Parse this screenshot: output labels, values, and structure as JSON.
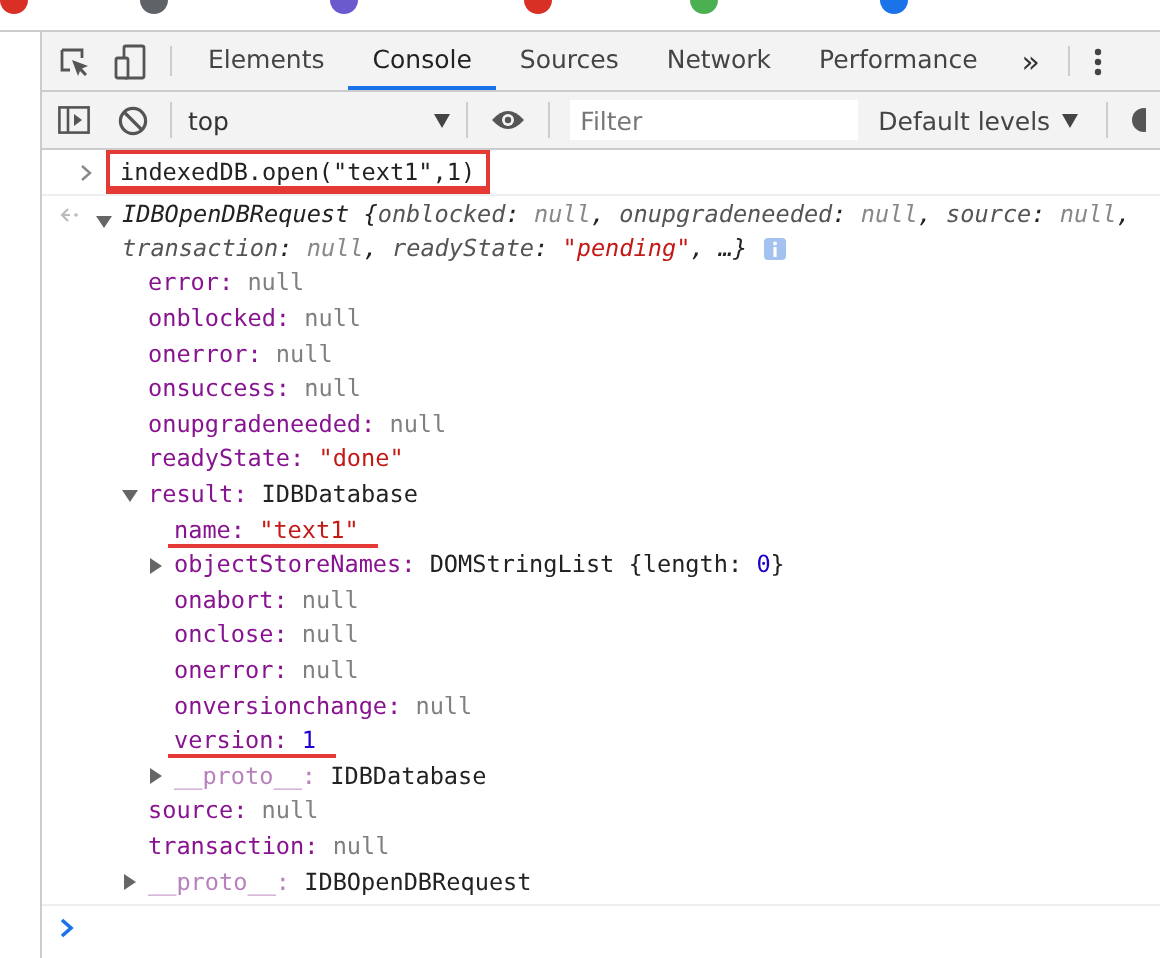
{
  "bookmarks_bar": {
    "icons": [
      {
        "color": "#d93025"
      },
      {
        "color": "#5f6368"
      },
      {
        "color": "#6a5acd"
      },
      {
        "color": "#d93025"
      },
      {
        "color": "#4caf50"
      },
      {
        "color": "#1a73e8"
      }
    ]
  },
  "tabs": [
    {
      "label": "Elements",
      "selected": false
    },
    {
      "label": "Console",
      "selected": true
    },
    {
      "label": "Sources",
      "selected": false
    },
    {
      "label": "Network",
      "selected": false
    },
    {
      "label": "Performance",
      "selected": false
    }
  ],
  "more_tabs": "»",
  "toolbar": {
    "context": "top",
    "filter": {
      "placeholder": "Filter"
    },
    "levels": "Default levels"
  },
  "console": {
    "input": {
      "text": "indexedDB.open(\"text1\",1)",
      "marked": true
    },
    "output": {
      "expanded": true,
      "summary": [
        [
          {
            "text": "IDBOpenDBRequest {",
            "kind": "plain"
          },
          {
            "text": "onblocked",
            "kind": "key"
          },
          {
            "text": ": ",
            "kind": "plain"
          },
          {
            "text": "null",
            "kind": "null"
          },
          {
            "text": ", ",
            "kind": "plain"
          },
          {
            "text": "onupgradeneeded",
            "kind": "key"
          },
          {
            "text": ": ",
            "kind": "plain"
          },
          {
            "text": "null",
            "kind": "null"
          },
          {
            "text": ", ",
            "kind": "plain"
          },
          {
            "text": "source",
            "kind": "key"
          },
          {
            "text": ": ",
            "kind": "plain"
          },
          {
            "text": "null",
            "kind": "null"
          },
          {
            "text": ",",
            "kind": "plain"
          }
        ],
        [
          {
            "text": "transaction",
            "kind": "key"
          },
          {
            "text": ": ",
            "kind": "plain"
          },
          {
            "text": "null",
            "kind": "null"
          },
          {
            "text": ", ",
            "kind": "plain"
          },
          {
            "text": "readyState",
            "kind": "key"
          },
          {
            "text": ": ",
            "kind": "plain"
          },
          {
            "text": "\"pending\"",
            "kind": "string"
          },
          {
            "text": ", …}",
            "kind": "plain"
          }
        ]
      ],
      "properties": [
        {
          "key": "error:",
          "kind": "leaf",
          "dimmed": false,
          "marked": false,
          "value": [
            {
              "text": "null",
              "kind": "null"
            }
          ]
        },
        {
          "key": "onblocked:",
          "kind": "leaf",
          "dimmed": false,
          "marked": false,
          "value": [
            {
              "text": "null",
              "kind": "null"
            }
          ]
        },
        {
          "key": "onerror:",
          "kind": "leaf",
          "dimmed": false,
          "marked": false,
          "value": [
            {
              "text": "null",
              "kind": "null"
            }
          ]
        },
        {
          "key": "onsuccess:",
          "kind": "leaf",
          "dimmed": false,
          "marked": false,
          "value": [
            {
              "text": "null",
              "kind": "null"
            }
          ]
        },
        {
          "key": "onupgradeneeded:",
          "kind": "leaf",
          "dimmed": false,
          "marked": false,
          "value": [
            {
              "text": "null",
              "kind": "null"
            }
          ]
        },
        {
          "key": "readyState:",
          "kind": "leaf",
          "dimmed": false,
          "marked": false,
          "value": [
            {
              "text": "\"done\"",
              "kind": "string"
            }
          ]
        },
        {
          "key": "result:",
          "kind": "node",
          "expanded": true,
          "dimmed": false,
          "marked": false,
          "value": [
            {
              "text": "IDBDatabase",
              "kind": "plain"
            }
          ],
          "children": [
            {
              "key": "name:",
              "kind": "leaf",
              "dimmed": false,
              "marked": true,
              "value": [
                {
                  "text": "\"text1\"",
                  "kind": "string"
                }
              ]
            },
            {
              "key": "objectStoreNames:",
              "kind": "node",
              "expanded": false,
              "dimmed": false,
              "marked": false,
              "value": [
                {
                  "text": "DOMStringList {length: ",
                  "kind": "plain"
                },
                {
                  "text": "0",
                  "kind": "number"
                },
                {
                  "text": "}",
                  "kind": "plain"
                }
              ]
            },
            {
              "key": "onabort:",
              "kind": "leaf",
              "dimmed": false,
              "marked": false,
              "value": [
                {
                  "text": "null",
                  "kind": "null"
                }
              ]
            },
            {
              "key": "onclose:",
              "kind": "leaf",
              "dimmed": false,
              "marked": false,
              "value": [
                {
                  "text": "null",
                  "kind": "null"
                }
              ]
            },
            {
              "key": "onerror:",
              "kind": "leaf",
              "dimmed": false,
              "marked": false,
              "value": [
                {
                  "text": "null",
                  "kind": "null"
                }
              ]
            },
            {
              "key": "onversionchange:",
              "kind": "leaf",
              "dimmed": false,
              "marked": false,
              "value": [
                {
                  "text": "null",
                  "kind": "null"
                }
              ]
            },
            {
              "key": "version:",
              "kind": "leaf",
              "dimmed": false,
              "marked": true,
              "value": [
                {
                  "text": "1",
                  "kind": "number"
                }
              ]
            },
            {
              "key": "__proto__:",
              "kind": "node",
              "expanded": false,
              "dimmed": true,
              "marked": false,
              "value": [
                {
                  "text": "IDBDatabase",
                  "kind": "plain"
                }
              ]
            }
          ]
        },
        {
          "key": "source:",
          "kind": "leaf",
          "dimmed": false,
          "marked": false,
          "value": [
            {
              "text": "null",
              "kind": "null"
            }
          ]
        },
        {
          "key": "transaction:",
          "kind": "leaf",
          "dimmed": false,
          "marked": false,
          "value": [
            {
              "text": "null",
              "kind": "null"
            }
          ]
        },
        {
          "key": "__proto__:",
          "kind": "node",
          "expanded": false,
          "dimmed": true,
          "marked": false,
          "value": [
            {
              "text": "IDBOpenDBRequest",
              "kind": "plain"
            }
          ]
        }
      ]
    }
  }
}
